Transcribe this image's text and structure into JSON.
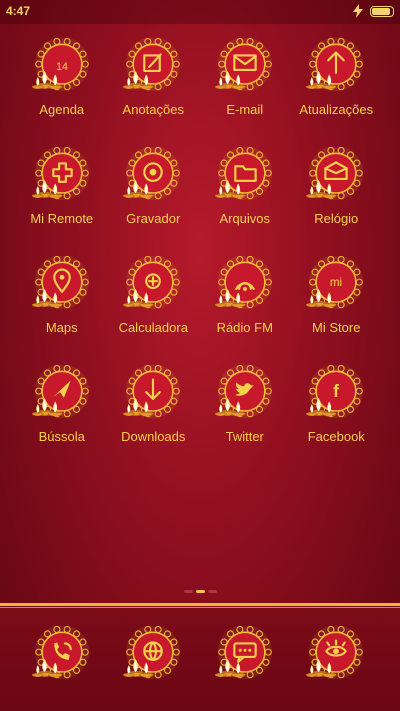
{
  "status": {
    "time": "4:47",
    "battery_level": 1.0
  },
  "colors": {
    "accent": "#f6d24c",
    "disc": "#c8182c",
    "ring": "#f0b83a"
  },
  "grid_rows": [
    [
      {
        "label": "Agenda",
        "icon": "calendar-icon",
        "glyph_text": "14"
      },
      {
        "label": "Anotações",
        "icon": "note-edit-icon"
      },
      {
        "label": "E-mail",
        "icon": "envelope-icon"
      },
      {
        "label": "Atualizações",
        "icon": "arrow-up-icon"
      }
    ],
    [
      {
        "label": "Mi Remote",
        "icon": "remote-plus-icon"
      },
      {
        "label": "Gravador",
        "icon": "record-icon"
      },
      {
        "label": "Arquivos",
        "icon": "folder-icon"
      },
      {
        "label": "Relógio",
        "icon": "clock-icon"
      }
    ],
    [
      {
        "label": "Maps",
        "icon": "map-pin-icon"
      },
      {
        "label": "Calculadora",
        "icon": "calculator-icon"
      },
      {
        "label": "Rádio FM",
        "icon": "radio-icon"
      },
      {
        "label": "Mi Store",
        "icon": "mi-store-icon",
        "glyph_text": "mi"
      }
    ],
    [
      {
        "label": "Bússola",
        "icon": "compass-icon"
      },
      {
        "label": "Downloads",
        "icon": "download-icon"
      },
      {
        "label": "Twitter",
        "icon": "twitter-bird-icon"
      },
      {
        "label": "Facebook",
        "icon": "facebook-f-icon",
        "glyph_text": "f"
      }
    ]
  ],
  "page_indicator": {
    "count": 3,
    "active": 1
  },
  "dock": [
    {
      "icon": "phone-icon"
    },
    {
      "icon": "globe-icon"
    },
    {
      "icon": "chat-bubble-icon"
    },
    {
      "icon": "eye-camera-icon"
    }
  ]
}
